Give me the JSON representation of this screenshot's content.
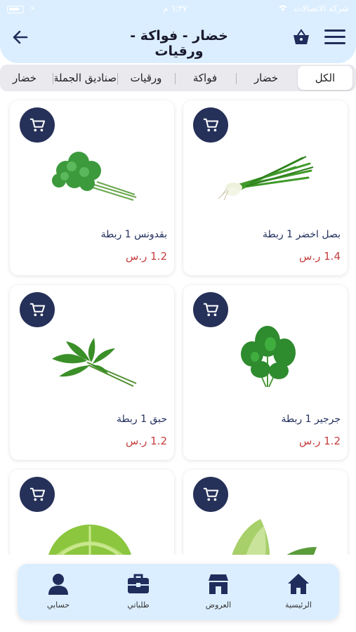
{
  "status_bar": {
    "carrier": "شركة الاتصالات",
    "time": "٦:٣٧ م"
  },
  "header": {
    "title": "خضار - فواكة - ورقيات"
  },
  "tabs": [
    {
      "label": "الكل",
      "active": true
    },
    {
      "label": "خضار",
      "active": false
    },
    {
      "label": "فواكة",
      "active": false
    },
    {
      "label": "ورقيات",
      "active": false
    },
    {
      "label": "صناديق الجملة",
      "active": false
    },
    {
      "label": "خضار",
      "active": false
    }
  ],
  "products": [
    {
      "name": "بصل اخضر 1 ربطة",
      "price": "1.4 ر.س",
      "image": "green-onion"
    },
    {
      "name": "بقدونس 1 ربطة",
      "price": "1.2 ر.س",
      "image": "parsley"
    },
    {
      "name": "جرجير 1 ربطة",
      "price": "1.2 ر.س",
      "image": "arugula"
    },
    {
      "name": "حبق 1 ربطة",
      "price": "1.2 ر.س",
      "image": "basil"
    },
    {
      "name": "",
      "price": "",
      "image": "romaine-lettuce"
    },
    {
      "name": "",
      "price": "",
      "image": "iceberg-lettuce"
    }
  ],
  "bottom_nav": [
    {
      "label": "الرئيسية",
      "icon": "home-icon"
    },
    {
      "label": "العروض",
      "icon": "store-icon"
    },
    {
      "label": "طلباتي",
      "icon": "briefcase-icon"
    },
    {
      "label": "حسابي",
      "icon": "user-icon"
    }
  ],
  "colors": {
    "header_bg": "#dbeeff",
    "accent": "#263159",
    "price": "#c43d3d",
    "text": "#1f2d5c"
  }
}
